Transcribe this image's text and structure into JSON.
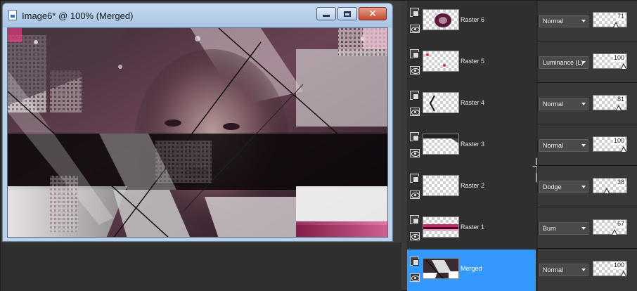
{
  "window": {
    "title": "Image6* @ 100% (Merged)",
    "controls": {
      "minimize": "minimize-icon",
      "maximize": "maximize-icon",
      "close": "close-icon",
      "close_glyph": "✕"
    }
  },
  "layers": [
    {
      "name": "Raster 6",
      "blend": "Normal",
      "opacity": 71,
      "selected": false
    },
    {
      "name": "Raster 5",
      "blend": "Luminance (L)",
      "opacity": 100,
      "selected": false
    },
    {
      "name": "Raster 4",
      "blend": "Normal",
      "opacity": 81,
      "selected": false
    },
    {
      "name": "Raster 3",
      "blend": "Normal",
      "opacity": 100,
      "selected": false
    },
    {
      "name": "Raster 2",
      "blend": "Dodge",
      "opacity": 38,
      "selected": false
    },
    {
      "name": "Raster 1",
      "blend": "Burn",
      "opacity": 67,
      "selected": false
    },
    {
      "name": "Merged",
      "blend": "Normal",
      "opacity": 100,
      "selected": true
    }
  ],
  "colors": {
    "selection": "#3399ff",
    "palette_bg": "#2d2d2d",
    "accent_magenta": "#c4286a",
    "titlebar": "#b9d1ea"
  }
}
